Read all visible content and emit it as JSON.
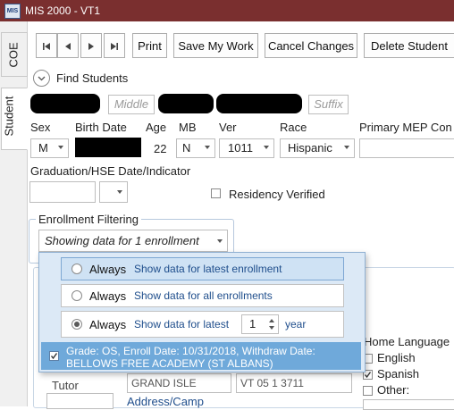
{
  "window": {
    "title": "MIS 2000 - VT1",
    "icon_text": "MIS"
  },
  "tabs": [
    "COE",
    "Student"
  ],
  "toolbar": {
    "print": "Print",
    "save": "Save My Work",
    "cancel": "Cancel Changes",
    "delete": "Delete Student"
  },
  "find_students": "Find Students",
  "name": {
    "middle_placeholder": "Middle",
    "suffix_placeholder": "Suffix"
  },
  "labels": {
    "sex": "Sex",
    "birth_date": "Birth Date",
    "age": "Age",
    "mb": "MB",
    "ver": "Ver",
    "race": "Race",
    "primary_mep": "Primary MEP Con",
    "graduation": "Graduation/HSE Date/Indicator",
    "residency": "Residency Verified"
  },
  "values": {
    "sex": "M",
    "age": "22",
    "mb": "N",
    "ver": "1011",
    "race": "Hispanic"
  },
  "enrollment_filtering": {
    "legend": "Enrollment Filtering",
    "selected": "Showing data for 1 enrollment",
    "options": [
      {
        "always": "Always",
        "desc": "Show data for latest enrollment"
      },
      {
        "always": "Always",
        "desc": "Show data for all enrollments"
      },
      {
        "always": "Always",
        "desc": "Show data for latest",
        "spin_value": "1",
        "unit": "year"
      }
    ],
    "enrollment_line1": "Grade: OS, Enroll Date: 10/31/2018, Withdraw Date:",
    "enrollment_line2": "BELLOWS FREE ACADEMY (ST ALBANS)"
  },
  "home_language": {
    "label": "Home Language",
    "english": "English",
    "spanish": "Spanish",
    "other": "Other:"
  },
  "background": {
    "tutor": "Tutor",
    "address": "Address/Camp",
    "grand_isle": "GRAND ISLE",
    "zip": "VT 05 1 3711"
  }
}
